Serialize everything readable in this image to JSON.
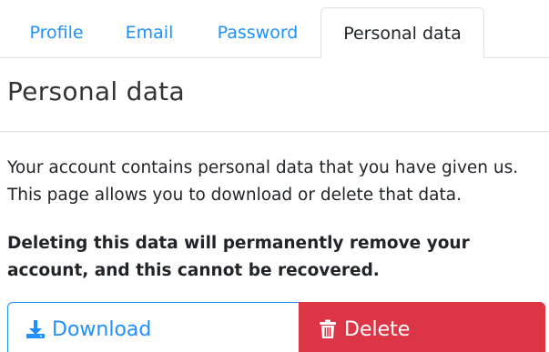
{
  "tabs": [
    {
      "label": "Profile"
    },
    {
      "label": "Email"
    },
    {
      "label": "Password"
    },
    {
      "label": "Personal data"
    }
  ],
  "main": {
    "title": "Personal data",
    "description": "Your account contains personal data that you have given us. This page allows you to download or delete that data.",
    "warning": "Deleting this data will permanently remove your account, and this cannot be recovered."
  },
  "actions": {
    "download_label": "Download",
    "delete_label": "Delete"
  },
  "icons": {
    "download": "download-icon",
    "delete": "trash-icon"
  },
  "colors": {
    "link": "#1e90ff",
    "danger": "#dc3545",
    "text": "#212529",
    "border": "#dee2e6"
  }
}
